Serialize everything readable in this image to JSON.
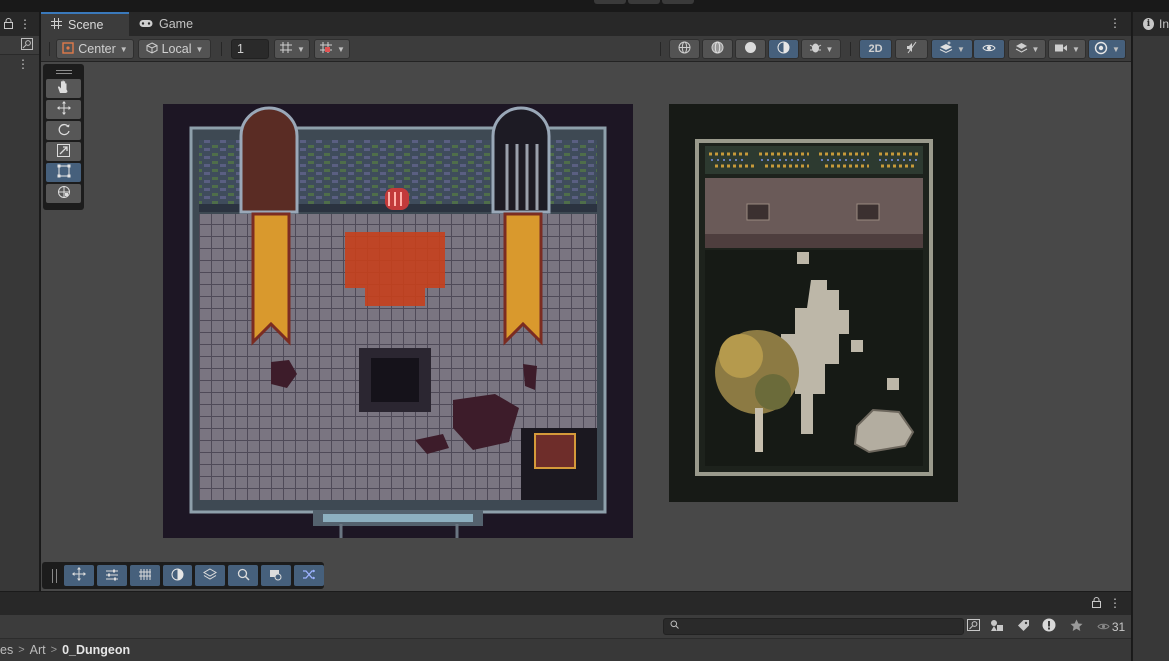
{
  "tabs": {
    "scene": "Scene",
    "game": "Game"
  },
  "toolbar": {
    "pivot_mode": "Center",
    "pivot_rotation": "Local",
    "grid_snap_value": "1",
    "mode_2d": "2D"
  },
  "inspector": {
    "tab_label": "In"
  },
  "project": {
    "search_placeholder": "",
    "visibility_count": "31",
    "breadcrumb": [
      "es",
      "Art",
      "0_Dungeon"
    ]
  },
  "colors": {
    "accent": "#3a79bb",
    "selected": "#46607c",
    "viewport_bg": "#484848"
  },
  "icons": {
    "scene_tab": "grid-icon",
    "game_tab": "gamepad-icon",
    "tools": [
      "hand-icon",
      "move-icon",
      "rotate-icon",
      "scale-icon",
      "rect-tool-icon",
      "transform-icon"
    ],
    "overlays": [
      "move-icon",
      "sliders-icon",
      "grid-icon",
      "moon-icon",
      "layers-icon",
      "search-icon",
      "camera-icon",
      "shuffle-icon"
    ]
  }
}
